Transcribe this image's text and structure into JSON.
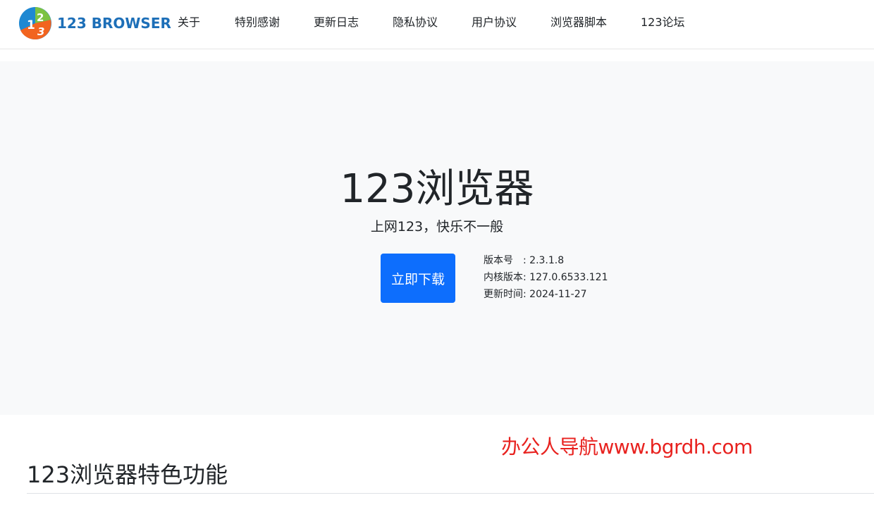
{
  "header": {
    "brand_name": "123 BROWSER",
    "logo_digits": [
      "1",
      "2",
      "3"
    ],
    "nav_items": [
      {
        "id": "about",
        "label": "关于"
      },
      {
        "id": "thanks",
        "label": "特别感谢"
      },
      {
        "id": "changelog",
        "label": "更新日志"
      },
      {
        "id": "privacy",
        "label": "隐私协议"
      },
      {
        "id": "user-agreement",
        "label": "用户协议"
      },
      {
        "id": "scripts",
        "label": "浏览器脚本"
      },
      {
        "id": "forum",
        "label": "123论坛"
      }
    ]
  },
  "hero": {
    "title": "123浏览器",
    "subtitle": "上网123，快乐不一般",
    "download_label": "立即下载",
    "info": {
      "version": "版本号　: 2.3.1.8",
      "kernel": "内核版本: 127.0.6533.121",
      "updated": "更新时间: 2024-11-27"
    }
  },
  "watermark": "办公人导航www.bgrdh.com",
  "features": {
    "title": "123浏览器特色功能"
  },
  "colors": {
    "brand_blue": "#1d6fb8",
    "button_blue": "#0d6efd",
    "hero_bg": "#f8f9fa",
    "watermark_red": "#e8221f",
    "logo_blue": "#1e88d2",
    "logo_green": "#7cc242",
    "logo_orange": "#f2641f"
  }
}
